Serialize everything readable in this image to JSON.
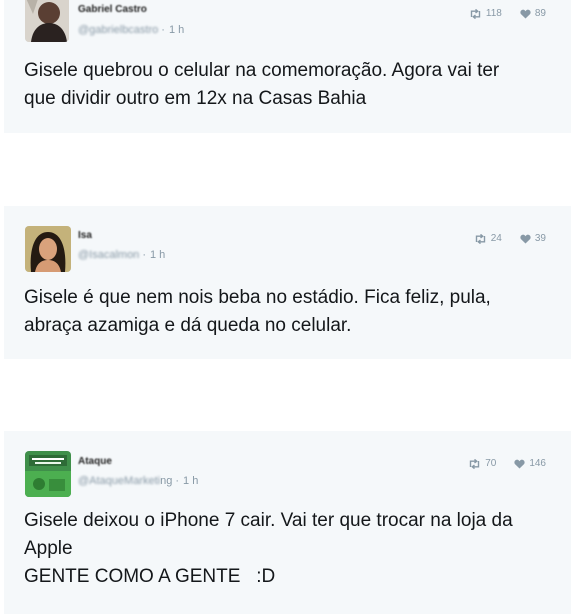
{
  "tweets": [
    {
      "name": "Gabriel Castro",
      "handle": "@gabrielbcastro",
      "time": "1 h",
      "retweets": "118",
      "likes": "89",
      "text_lines": [
        "Gisele quebrou o celular na comemoração. Agora vai ter",
        "que dividir outro em 12x na Casas Bahia"
      ],
      "avatar_icon": "person-dark-avatar"
    },
    {
      "name": "Isa",
      "handle": "@Isacalmon",
      "time": "1 h",
      "retweets": "24",
      "likes": "39",
      "text_lines": [
        "Gisele é que nem nois beba no estádio. Fica feliz, pula,",
        "abraça azamiga e dá queda no celular."
      ],
      "avatar_icon": "woman-avatar"
    },
    {
      "name": "Ataque",
      "handle": "@AtaqueMarketi",
      "handle_tail": "ng",
      "time": "1 h",
      "retweets": "70",
      "likes": "146",
      "text_lines": [
        "Gisele deixou o iPhone 7 cair. Vai ter que trocar na loja da",
        "Apple",
        "GENTE COMO A GENTE   :D"
      ],
      "avatar_icon": "green-logo-avatar"
    }
  ],
  "colors": {
    "tweet_bg": "#f5f8fa",
    "meta_gray": "#8899a6",
    "text": "#14171a"
  },
  "icons": {
    "retweet": "retweet-icon",
    "like": "heart-icon"
  }
}
